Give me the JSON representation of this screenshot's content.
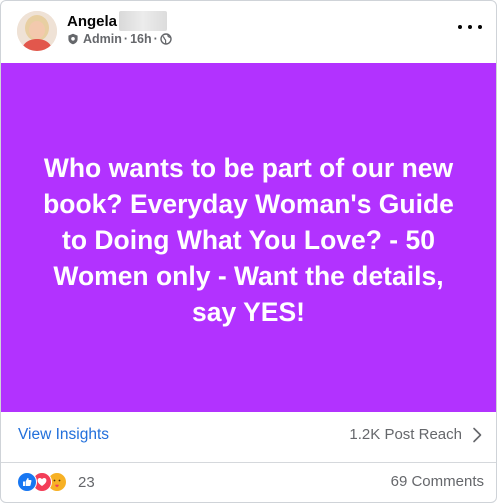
{
  "post": {
    "author_name": "Angela",
    "role": "Admin",
    "time": "16h",
    "banner_background": "#b232ff",
    "banner_text": "Who wants to be part of our new book? Everyday Woman's Guide to Doing What You Love? - 50 Women only - Want the details, say YES!"
  },
  "insights": {
    "view_label": "View Insights",
    "reach": "1.2K Post Reach"
  },
  "engagement": {
    "reaction_count": "23",
    "comments": "69 Comments",
    "reaction_icons": [
      "like-icon",
      "love-icon",
      "care-icon"
    ]
  },
  "colors": {
    "link": "#216fdb",
    "secondary_text": "#65676b"
  }
}
